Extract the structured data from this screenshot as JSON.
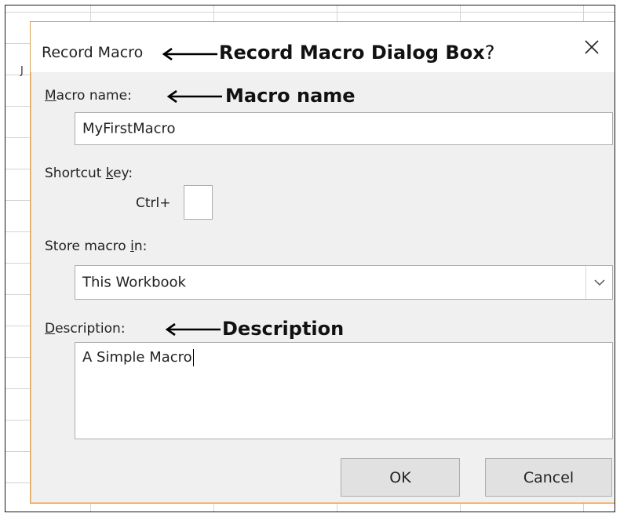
{
  "sheet": {
    "column_letter": "J"
  },
  "dialog": {
    "title": "Record Macro",
    "close_glyph": "✕",
    "annotations": {
      "title": "Record Macro Dialog Box",
      "macro_name": "Macro name",
      "description": "Description"
    },
    "macro_name": {
      "label_accel": "M",
      "label_rest": "acro name:",
      "value": "MyFirstMacro"
    },
    "shortcut": {
      "label_pre": "Shortcut ",
      "label_accel": "k",
      "label_post": "ey:",
      "ctrl_label": "Ctrl+",
      "value": ""
    },
    "store": {
      "label_pre": "Store macro ",
      "label_accel": "i",
      "label_post": "n:",
      "selected": "This Workbook"
    },
    "description": {
      "label_accel": "D",
      "label_rest": "escription:",
      "value": "A Simple Macro"
    },
    "buttons": {
      "ok": "OK",
      "cancel": "Cancel"
    }
  }
}
